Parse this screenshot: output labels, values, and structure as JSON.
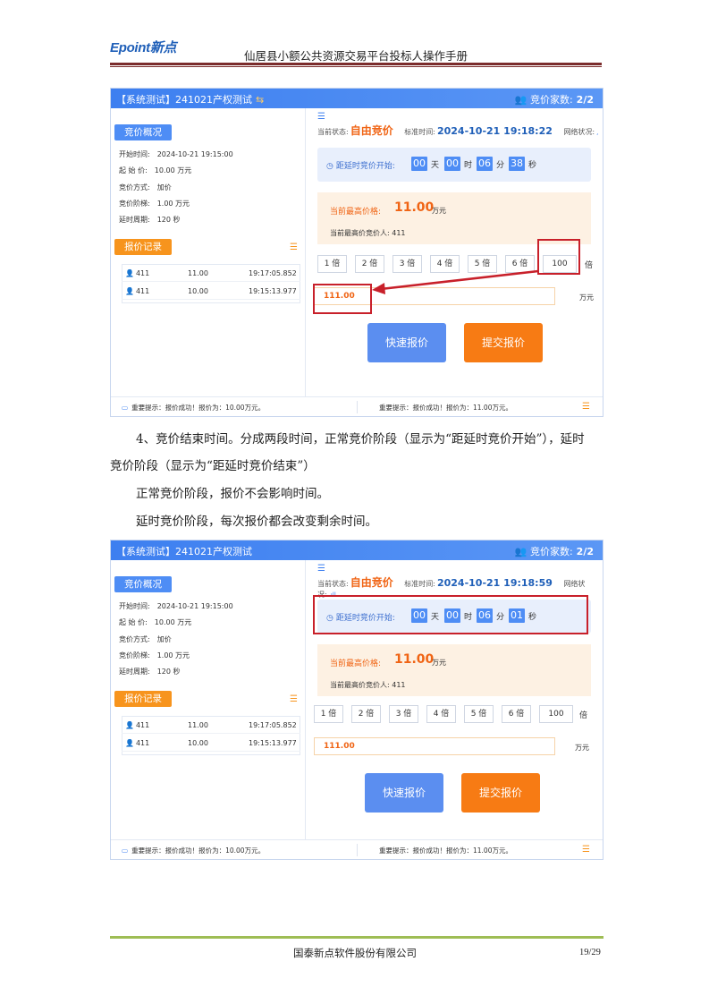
{
  "header": {
    "logo_text": "Epoint新点",
    "doc_title": "仙居县小额公共资源交易平台投标人操作手册"
  },
  "colors": {
    "primary": "#4e8df5",
    "accent": "#f7941d",
    "highlight": "#c8202a",
    "footer_line": "#9ebd54"
  },
  "screens": [
    {
      "title": "【系统测试】241021产权测试",
      "bidders_label": "竞价家数:",
      "bidders_value": "2/2",
      "overview_title": "竞价概况",
      "info": [
        "开始时间:　2024-10-21 19:15:00",
        "起 始 价:　10.00 万元",
        "竞价方式:　加价",
        "竞价阶梯:　1.00 万元",
        "延时周期:　120 秒"
      ],
      "records_title": "报价记录",
      "records": [
        {
          "user": "411",
          "price": "11.00",
          "time": "19:17:05.852"
        },
        {
          "user": "411",
          "price": "10.00",
          "time": "19:15:13.977"
        }
      ],
      "status_label": "当前状态:",
      "status_value": "自由竞价",
      "std_time_label": "标准时间:",
      "std_time_value": "2024-10-21 19:18:22",
      "network_label": "网络状况:",
      "network_value": ",",
      "countdown_label": "距延时竞价开始:",
      "countdown": {
        "d": "00",
        "h": "00",
        "m": "06",
        "s": "38"
      },
      "units": {
        "d": "天",
        "h": "时",
        "m": "分",
        "s": "秒"
      },
      "highest_label": "当前最高价格:",
      "highest_value": "11.00",
      "highest_unit": "万元",
      "highest_bidder": "当前最高价竞价人: 411",
      "multipliers": [
        "1 倍",
        "2 倍",
        "3 倍",
        "4 倍",
        "5 倍",
        "6 倍"
      ],
      "custom_mult": "100",
      "bei": "倍",
      "bid_value": "111.00",
      "bid_unit": "万元",
      "btn_quick": "快速报价",
      "btn_submit": "提交报价",
      "footer_left": "重要提示：报价成功！报价为：10.00万元。",
      "footer_right": "重要提示：报价成功！报价为：11.00万元。"
    },
    {
      "title": "【系统测试】241021产权测试",
      "bidders_label": "竞价家数:",
      "bidders_value": "2/2",
      "overview_title": "竞价概况",
      "info": [
        "开始时间:　2024-10-21 19:15:00",
        "起 始 价:　10.00 万元",
        "竞价方式:　加价",
        "竞价阶梯:　1.00 万元",
        "延时周期:　120 秒"
      ],
      "records_title": "报价记录",
      "records": [
        {
          "user": "411",
          "price": "11.00",
          "time": "19:17:05.852"
        },
        {
          "user": "411",
          "price": "10.00",
          "time": "19:15:13.977"
        }
      ],
      "status_label": "当前状态:",
      "status_value": "自由竞价",
      "std_time_label": "标准时间:",
      "std_time_value": "2024-10-21 19:18:59",
      "network_label": "网络状况:",
      "network_value": ".ıll",
      "countdown_label": "距延时竞价开始:",
      "countdown": {
        "d": "00",
        "h": "00",
        "m": "06",
        "s": "01"
      },
      "units": {
        "d": "天",
        "h": "时",
        "m": "分",
        "s": "秒"
      },
      "highest_label": "当前最高价格:",
      "highest_value": "11.00",
      "highest_unit": "万元",
      "highest_bidder": "当前最高价竞价人: 411",
      "multipliers": [
        "1 倍",
        "2 倍",
        "3 倍",
        "4 倍",
        "5 倍",
        "6 倍"
      ],
      "custom_mult": "100",
      "bei": "倍",
      "bid_value": "111.00",
      "bid_unit": "万元",
      "btn_quick": "快速报价",
      "btn_submit": "提交报价",
      "footer_left": "重要提示：报价成功！报价为：10.00万元。",
      "footer_right": "重要提示：报价成功！报价为：11.00万元。"
    }
  ],
  "body": {
    "p1a": "4、竞价结束时间。分成两段时间，正常竞价阶段（显示为“距延时竞价开始”），延时",
    "p1b": "竞价阶段（显示为“距延时竞价结束”）",
    "p2": "正常竞价阶段，报价不会影响时间。",
    "p3": "延时竞价阶段，每次报价都会改变剩余时间。"
  },
  "footer": {
    "company": "国泰新点软件股份有限公司",
    "page": "19/29"
  }
}
